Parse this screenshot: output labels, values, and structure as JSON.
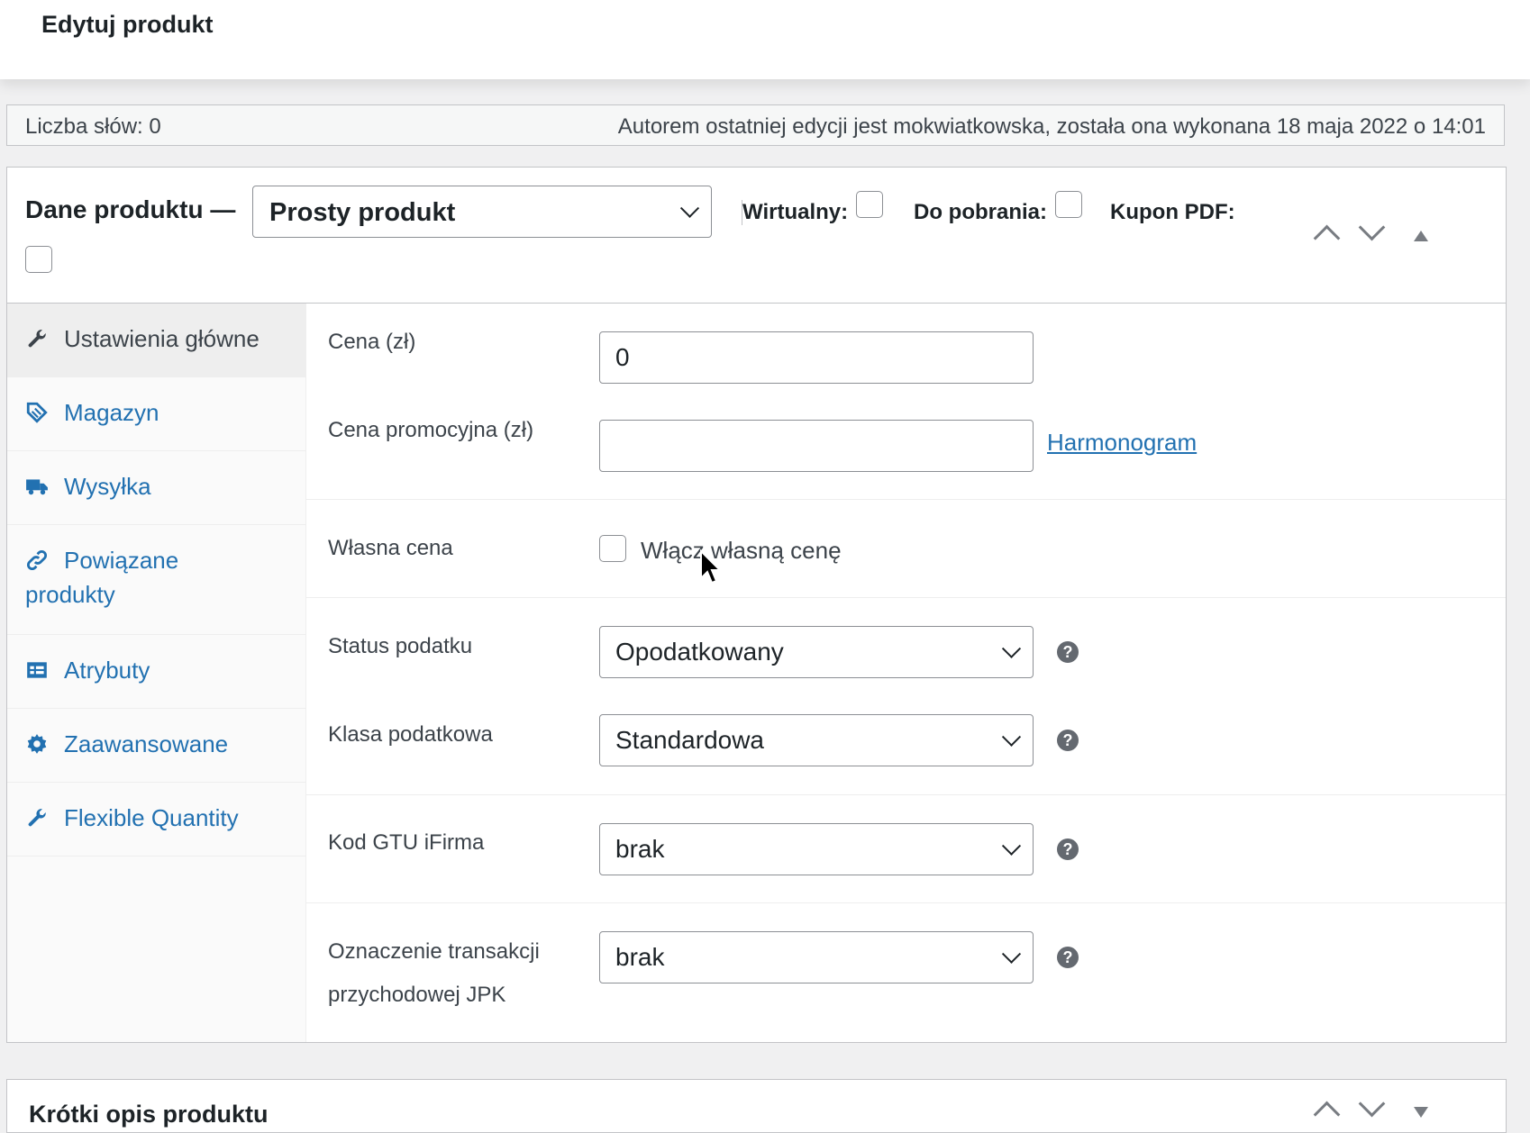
{
  "header": {
    "title": "Edytuj produkt"
  },
  "word_count_bar": {
    "word_count": "Liczba słów: 0",
    "last_edit": "Autorem ostatniej edycji jest mokwiatkowska, została ona wykonana 18 maja 2022 o 14:01"
  },
  "product_data": {
    "label": "Dane produktu —",
    "type_select": "Prosty produkt",
    "virtual_label": "Wirtualny:",
    "downloadable_label": "Do pobrania:",
    "pdf_coupon_label": "Kupon PDF:"
  },
  "tabs": [
    {
      "label": "Ustawienia główne",
      "icon": "wrench-icon",
      "active": true
    },
    {
      "label": "Magazyn",
      "icon": "tag-icon"
    },
    {
      "label": "Wysyłka",
      "icon": "truck-icon"
    },
    {
      "label": "Powiązane",
      "label2": "produkty",
      "icon": "link-icon"
    },
    {
      "label": "Atrybuty",
      "icon": "list-icon"
    },
    {
      "label": "Zaawansowane",
      "icon": "gear-icon"
    },
    {
      "label": "Flexible Quantity",
      "icon": "wrench-icon"
    }
  ],
  "general": {
    "price_label": "Cena (zł)",
    "price_value": "0",
    "sale_price_label": "Cena promocyjna (zł)",
    "sale_price_value": "",
    "schedule_link": "Harmonogram",
    "custom_price_label": "Własna cena",
    "custom_price_checkbox_label": "Włącz własną cenę",
    "tax_status_label": "Status podatku",
    "tax_status_value": "Opodatkowany",
    "tax_class_label": "Klasa podatkowa",
    "tax_class_value": "Standardowa",
    "gtu_label": "Kod GTU iFirma",
    "gtu_value": "brak",
    "jpk_label_line1": "Oznaczenie transakcji",
    "jpk_label_line2": "przychodowej JPK",
    "jpk_value": "brak",
    "help_glyph": "?"
  },
  "short_description": {
    "label": "Krótki opis produktu"
  }
}
